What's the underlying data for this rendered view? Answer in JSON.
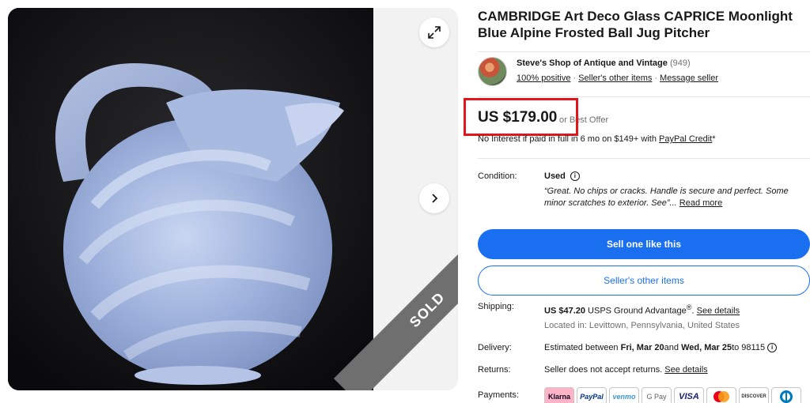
{
  "listing": {
    "title": "CAMBRIDGE Art Deco Glass CAPRICE Moonlight Blue Alpine Frosted Ball Jug Pitcher",
    "sold_label": "SOLD"
  },
  "seller": {
    "name": "Steve's Shop of Antique and Vintage",
    "count": "(949)",
    "positive": "100% positive",
    "other_items": "Seller's other items",
    "message": "Message seller"
  },
  "price": {
    "amount": "US $179.00",
    "best_offer": "or Best Offer",
    "finance_text": "No Interest if paid in full in 6 mo on $149+ with ",
    "finance_link": "PayPal Credit",
    "finance_suffix": "*"
  },
  "condition": {
    "label": "Condition:",
    "value": "Used",
    "description": "“Great. No chips or cracks. Handle is secure and perfect. Some minor scratches to exterior. See”...",
    "read_more": "Read more"
  },
  "buttons": {
    "sell_one": "Sell one like this",
    "seller_items": "Seller's other items"
  },
  "shipping": {
    "label": "Shipping:",
    "cost": "US $47.20",
    "service": " USPS Ground Advantage",
    "service_mark": "®",
    "see_details": "See details",
    "location": "Located in: Levittown, Pennsylvania, United States"
  },
  "delivery": {
    "label": "Delivery:",
    "prefix": "Estimated between ",
    "start": "Fri, Mar 20",
    "and": " and ",
    "end": "Wed, Mar 25",
    "to": " to 98115"
  },
  "returns": {
    "label": "Returns:",
    "text": "Seller does not accept returns. ",
    "see_details": "See details"
  },
  "payments": {
    "label": "Payments:",
    "methods": [
      "Klarna",
      "PayPal",
      "venmo",
      "G Pay",
      "VISA",
      "Mastercard",
      "DISCOVER",
      "Diners"
    ]
  },
  "colors": {
    "accent": "#1a6ff0",
    "highlight_box": "#e0161b",
    "sold_ribbon": "#6f6f6f"
  }
}
